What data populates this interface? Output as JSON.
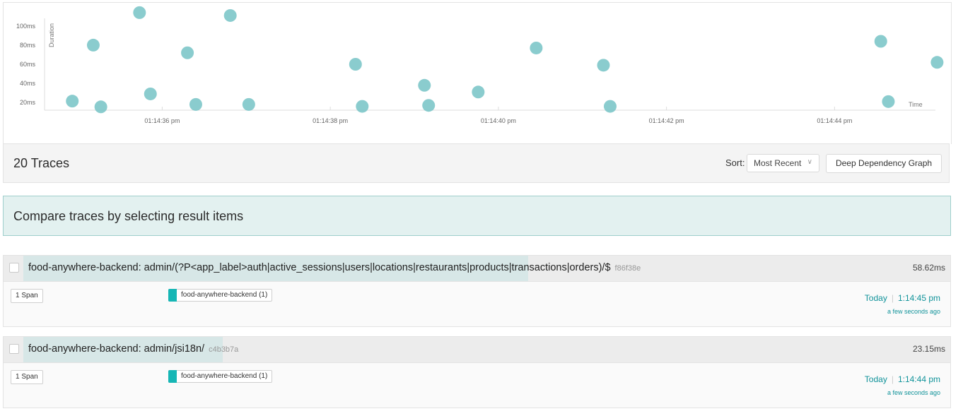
{
  "chart_data": {
    "type": "scatter",
    "xlabel": "Time",
    "ylabel": "Duration",
    "y_ticks": [
      "100ms",
      "80ms",
      "60ms",
      "40ms",
      "20ms"
    ],
    "x_ticks": [
      "01:14:36 pm",
      "01:14:38 pm",
      "01:14:40 pm",
      "01:14:42 pm",
      "01:14:44 pm"
    ],
    "ylim_ms": [
      12,
      108
    ],
    "points": [
      {
        "t": 34.93,
        "ms": 21.5
      },
      {
        "t": 35.27,
        "ms": 15.5
      },
      {
        "t": 35.18,
        "ms": 80
      },
      {
        "t": 35.73,
        "ms": 114
      },
      {
        "t": 35.86,
        "ms": 29
      },
      {
        "t": 36.3,
        "ms": 72
      },
      {
        "t": 36.4,
        "ms": 18
      },
      {
        "t": 36.81,
        "ms": 111
      },
      {
        "t": 37.03,
        "ms": 18
      },
      {
        "t": 38.3,
        "ms": 60
      },
      {
        "t": 38.38,
        "ms": 16
      },
      {
        "t": 39.12,
        "ms": 38
      },
      {
        "t": 39.17,
        "ms": 17
      },
      {
        "t": 39.76,
        "ms": 31
      },
      {
        "t": 40.45,
        "ms": 77
      },
      {
        "t": 41.25,
        "ms": 59
      },
      {
        "t": 41.33,
        "ms": 16
      },
      {
        "t": 44.55,
        "ms": 84
      },
      {
        "t": 44.64,
        "ms": 21
      },
      {
        "t": 45.22,
        "ms": 62
      }
    ]
  },
  "results": {
    "count_label": "20 Traces",
    "sort_label": "Sort:",
    "sort_value": "Most Recent",
    "ddg_button": "Deep Dependency Graph"
  },
  "compare_banner": "Compare traces by selecting result items",
  "traces": [
    {
      "title": "food-anywhere-backend: admin/(?P<app_label>auth|active_sessions|users|locations|restaurants|products|transactions|orders)/$",
      "trace_id": "f86f38e",
      "duration": "58.62ms",
      "span_count": "1 Span",
      "service": "food-anywhere-backend (1)",
      "date": "Today",
      "time": "1:14:45 pm",
      "ago": "a few seconds ago",
      "service_color": "#16b6b5"
    },
    {
      "title": "food-anywhere-backend: admin/jsi18n/",
      "trace_id": "c4b3b7a",
      "duration": "23.15ms",
      "span_count": "1 Span",
      "service": "food-anywhere-backend (1)",
      "date": "Today",
      "time": "1:14:44 pm",
      "ago": "a few seconds ago",
      "service_color": "#16b6b5"
    }
  ],
  "colors": {
    "accent": "#11939a",
    "point": "#7dc6c9",
    "banner_bg": "#e3f1f0"
  }
}
